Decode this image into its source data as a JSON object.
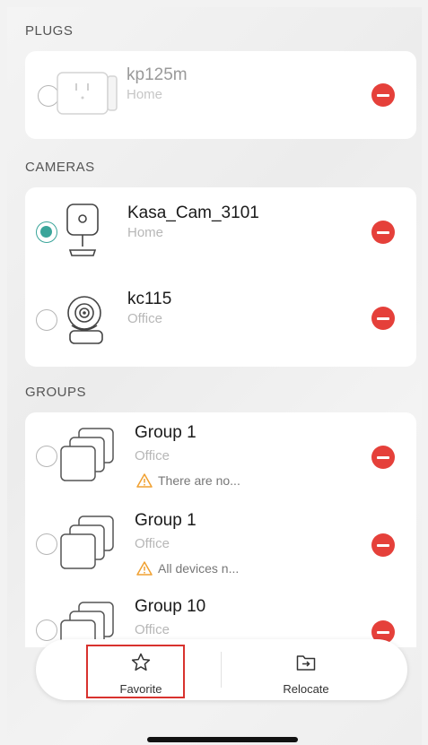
{
  "sections": {
    "plugs": {
      "label": "PLUGS",
      "devices": [
        {
          "name": "kp125m",
          "location": "Home",
          "icon": "smart-plug-icon",
          "selected": false,
          "dimmed": true
        }
      ]
    },
    "cameras": {
      "label": "CAMERAS",
      "devices": [
        {
          "name": "Kasa_Cam_3101",
          "location": "Home",
          "icon": "indoor-camera-icon",
          "selected": true
        },
        {
          "name": "kc115",
          "location": "Office",
          "icon": "pan-tilt-camera-icon",
          "selected": false
        }
      ]
    },
    "groups": {
      "label": "GROUPS",
      "items": [
        {
          "name": "Group 1",
          "location": "Office",
          "warning": "There are no...",
          "icon": "device-group-icon"
        },
        {
          "name": "Group 1",
          "location": "Office",
          "warning": "All devices n...",
          "icon": "device-group-icon"
        },
        {
          "name": "Group 10",
          "location": "Office",
          "icon": "device-group-icon"
        }
      ]
    }
  },
  "actions": {
    "favorite_label": "Favorite",
    "favorite_icon": "star-outline-icon",
    "relocate_label": "Relocate",
    "relocate_icon": "folder-move-icon"
  },
  "colors": {
    "accent": "#3aa59a",
    "remove": "#e5403a",
    "warning": "#f0a030",
    "highlight": "#d8322e"
  }
}
